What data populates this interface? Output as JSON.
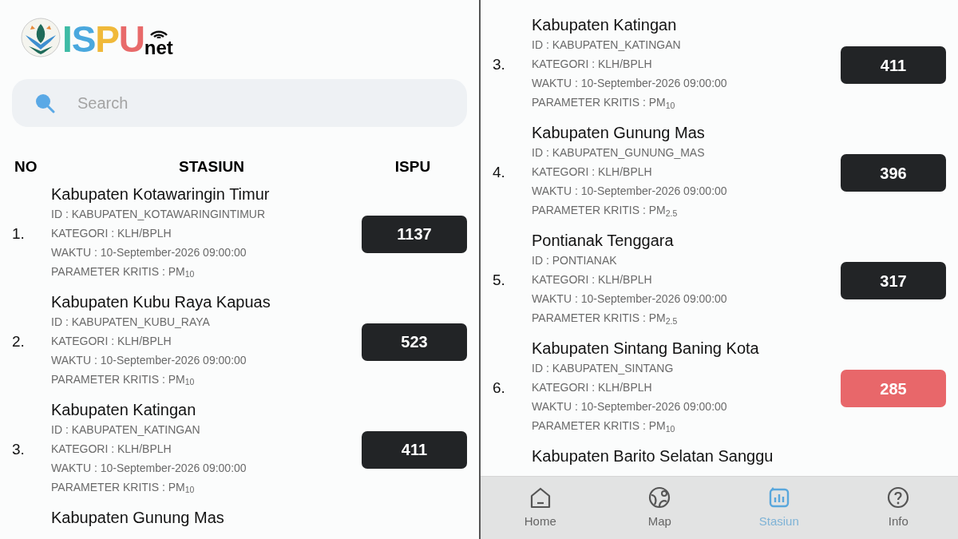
{
  "logo": {
    "letters": [
      {
        "text": "I",
        "color": "#3dbba5"
      },
      {
        "text": "S",
        "color": "#4aa8de"
      },
      {
        "text": "P",
        "color": "#f0b93a"
      },
      {
        "text": "U",
        "color": "#e86a6a"
      }
    ],
    "suffix": "net"
  },
  "search": {
    "placeholder": "Search"
  },
  "table": {
    "columns": [
      "NO",
      "STASIUN",
      "ISPU"
    ]
  },
  "left_rows": [
    {
      "no": "1.",
      "name": "Kabupaten Kotawaringin Timur",
      "id": "ID : KABUPATEN_KOTAWARINGINTIMUR",
      "category": "KATEGORI : KLH/BPLH",
      "time": "WAKTU : 10-September-2026 09:00:00",
      "parameter": "PARAMETER KRITIS : PM$_{10}$",
      "ispu": "1137",
      "color": "#222426"
    },
    {
      "no": "2.",
      "name": "Kabupaten Kubu Raya Kapuas",
      "id": "ID : KABUPATEN_KUBU_RAYA",
      "category": "KATEGORI : KLH/BPLH",
      "time": "WAKTU : 10-September-2026 09:00:00",
      "parameter": "PARAMETER KRITIS : PM$_{10}$",
      "ispu": "523",
      "color": "#222426"
    },
    {
      "no": "3.",
      "name": "Kabupaten Katingan",
      "id": "ID : KABUPATEN_KATINGAN",
      "category": "KATEGORI : KLH/BPLH",
      "time": "WAKTU : 10-September-2026 09:00:00",
      "parameter": "PARAMETER KRITIS : PM$_{10}$",
      "ispu": "411",
      "color": "#222426"
    },
    {
      "name": "Kabupaten Gunung Mas"
    }
  ],
  "right_rows": [
    {
      "no": "3.",
      "name": "Kabupaten Katingan",
      "id": "ID : KABUPATEN_KATINGAN",
      "category": "KATEGORI : KLH/BPLH",
      "time": "WAKTU : 10-September-2026 09:00:00",
      "parameter": "PARAMETER KRITIS : PM$_{10}$",
      "ispu": "411",
      "color": "#222426"
    },
    {
      "no": "4.",
      "name": "Kabupaten Gunung Mas",
      "id": "ID : KABUPATEN_GUNUNG_MAS",
      "category": "KATEGORI : KLH/BPLH",
      "time": "WAKTU : 10-September-2026 09:00:00",
      "parameter": "PARAMETER KRITIS : PM$_{2.5}$",
      "ispu": "396",
      "color": "#222426"
    },
    {
      "no": "5.",
      "name": "Pontianak Tenggara",
      "id": "ID : PONTIANAK",
      "category": "KATEGORI : KLH/BPLH",
      "time": "WAKTU : 10-September-2026 09:00:00",
      "parameter": "PARAMETER KRITIS : PM$_{2.5}$",
      "ispu": "317",
      "color": "#222426"
    },
    {
      "no": "6.",
      "name": "Kabupaten Sintang Baning Kota",
      "id": "ID : KABUPATEN_SINTANG",
      "category": "KATEGORI : KLH/BPLH",
      "time": "WAKTU : 10-September-2026 09:00:00",
      "parameter": "PARAMETER KRITIS : PM$_{10}$",
      "ispu": "285",
      "color": "#e8676a"
    },
    {
      "name": "Kabupaten Barito Selatan Sanggu"
    }
  ],
  "bottom_nav": [
    {
      "kind": "home",
      "label": "Home",
      "selected": false
    },
    {
      "kind": "map",
      "label": "Map",
      "selected": false
    },
    {
      "kind": "stasiun",
      "label": "Stasiun",
      "selected": true
    },
    {
      "kind": "info",
      "label": "Info",
      "selected": false
    }
  ]
}
